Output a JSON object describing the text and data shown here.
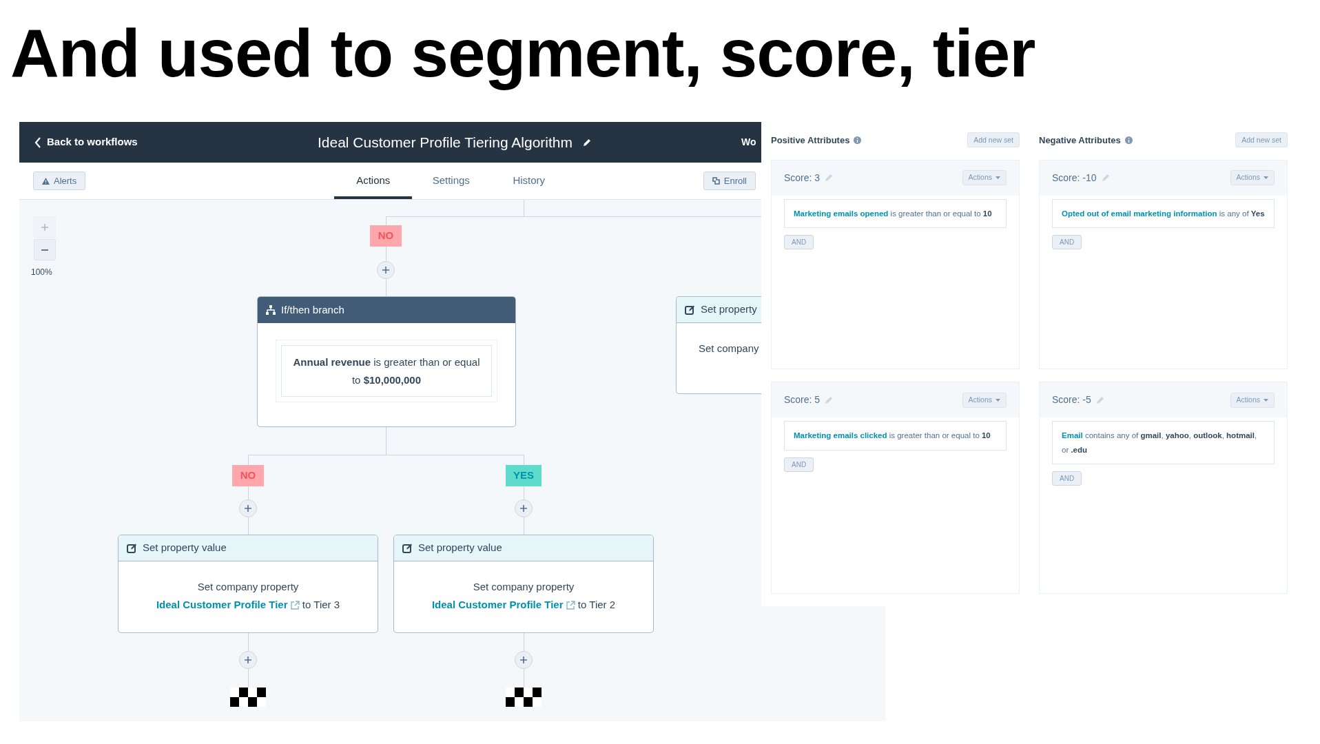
{
  "slide_title": "And used to segment, score, tier",
  "workflow": {
    "back_link": "Back to workflows",
    "title": "Ideal Customer Profile Tiering Algorithm",
    "header_cut_text": "Wo",
    "alerts_button": "Alerts",
    "tabs": [
      {
        "label": "Actions",
        "selected": true
      },
      {
        "label": "Settings",
        "selected": false
      },
      {
        "label": "History",
        "selected": false
      }
    ],
    "enroll_button": "Enroll",
    "zoom": {
      "zoom_in_disabled": true,
      "zoom_out_disabled": false,
      "level_text": "100%"
    },
    "top_label": {
      "text": "NO",
      "kind": "no"
    },
    "branch_node": {
      "title": "If/then branch",
      "condition": "**Annual revenue** is greater than or equal to **$10,000,000**"
    },
    "side_node": {
      "title": "Set property",
      "body": "Set company"
    },
    "branches": [
      {
        "label": {
          "text": "NO",
          "kind": "no"
        },
        "node": {
          "title": "Set property value",
          "text_before": "Set company property",
          "property": "Ideal Customer Profile Tier",
          "text_after": "to Tier 3"
        }
      },
      {
        "label": {
          "text": "YES",
          "kind": "yes"
        },
        "node": {
          "title": "Set property value",
          "text_before": "Set company property",
          "property": "Ideal Customer Profile Tier",
          "text_after": "to Tier 2"
        }
      }
    ]
  },
  "scoring": {
    "columns": [
      {
        "title": "Positive Attributes",
        "add_button": "Add new set",
        "sets": [
          {
            "score": "Score: 3",
            "actions_button": "Actions",
            "property": "Marketing emails opened",
            "condition": "is greater than or equal to **10**",
            "and_button": "AND"
          },
          {
            "score": "Score: 5",
            "actions_button": "Actions",
            "property": "Marketing emails clicked",
            "condition": "is greater than or equal to **10**",
            "and_button": "AND"
          }
        ]
      },
      {
        "title": "Negative Attributes",
        "add_button": "Add new set",
        "sets": [
          {
            "score": "Score: -10",
            "actions_button": "Actions",
            "property": "Opted out of email marketing information",
            "condition": "is any of **Yes**",
            "and_button": "AND"
          },
          {
            "score": "Score: -5",
            "actions_button": "Actions",
            "property": "Email",
            "condition": "contains any of **gmail**, **yahoo**, **outlook**, **hotmail**, or **.edu**",
            "and_button": "AND"
          }
        ]
      }
    ]
  }
}
